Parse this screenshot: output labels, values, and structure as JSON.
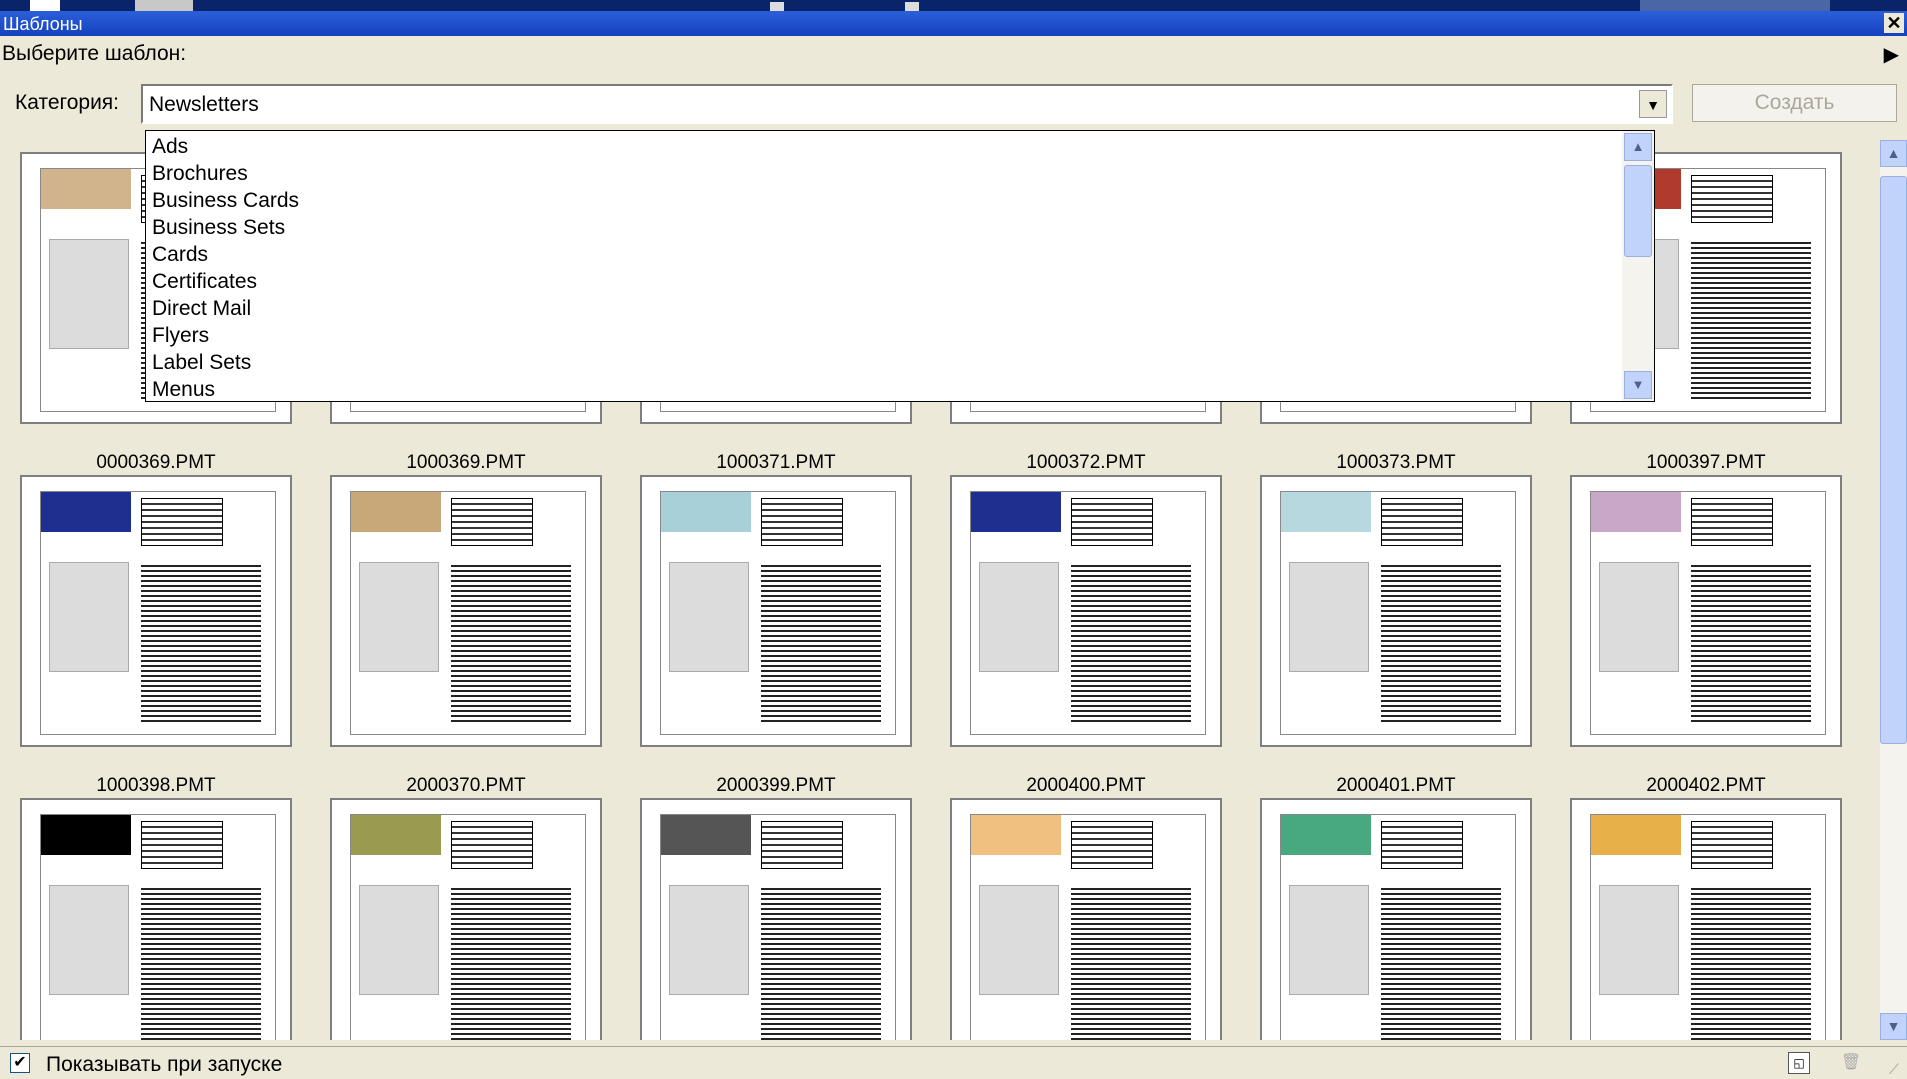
{
  "window": {
    "title": "Шаблоны",
    "close_glyph": "✕"
  },
  "prompt": {
    "text": "Выберите шаблон:",
    "arrow_glyph": "▶"
  },
  "category": {
    "label": "Категория:",
    "value": "Newsletters",
    "drop_glyph": "▼",
    "options": [
      "Ads",
      "Brochures",
      "Business Cards",
      "Business Sets",
      "Cards",
      "Certificates",
      "Direct Mail",
      "Flyers",
      "Label Sets",
      "Menus"
    ]
  },
  "create_button": {
    "label": "Создать"
  },
  "templates": [
    {
      "name": "0000369.PMT",
      "accent": "#d2b48c"
    },
    {
      "name": "1000369.PMT",
      "accent": "#c0a070"
    },
    {
      "name": "1000371.PMT",
      "accent": "#88b888"
    },
    {
      "name": "1000372.PMT",
      "accent": "#b8a0c8"
    },
    {
      "name": "1000373.PMT",
      "accent": "#999999"
    },
    {
      "name": "1000397.PMT",
      "accent": "#b03a2e"
    },
    {
      "name": "1000398.PMT",
      "accent": "#1f2f8f"
    },
    {
      "name": "2000370.PMT",
      "accent": "#c8a878"
    },
    {
      "name": "2000399.PMT",
      "accent": "#a8d0d8"
    },
    {
      "name": "2000400.PMT",
      "accent": "#1f2f8f"
    },
    {
      "name": "2000401.PMT",
      "accent": "#b8d8e0"
    },
    {
      "name": "2000402.PMT",
      "accent": "#c8a8c8"
    },
    {
      "name": "",
      "accent": "#000000"
    },
    {
      "name": "",
      "accent": "#9a9a50"
    },
    {
      "name": "",
      "accent": "#555555"
    },
    {
      "name": "",
      "accent": "#f0c080"
    },
    {
      "name": "",
      "accent": "#48a880"
    },
    {
      "name": "",
      "accent": "#e8b048"
    }
  ],
  "status": {
    "show_on_startup_label": "Показывать при запуске",
    "show_on_startup_checked": true,
    "check_glyph": "✔"
  },
  "icons": {
    "scroll_up": "▲",
    "scroll_down": "▼",
    "new_icon": "◱",
    "delete_icon": "🗑",
    "grip": "⟋"
  }
}
